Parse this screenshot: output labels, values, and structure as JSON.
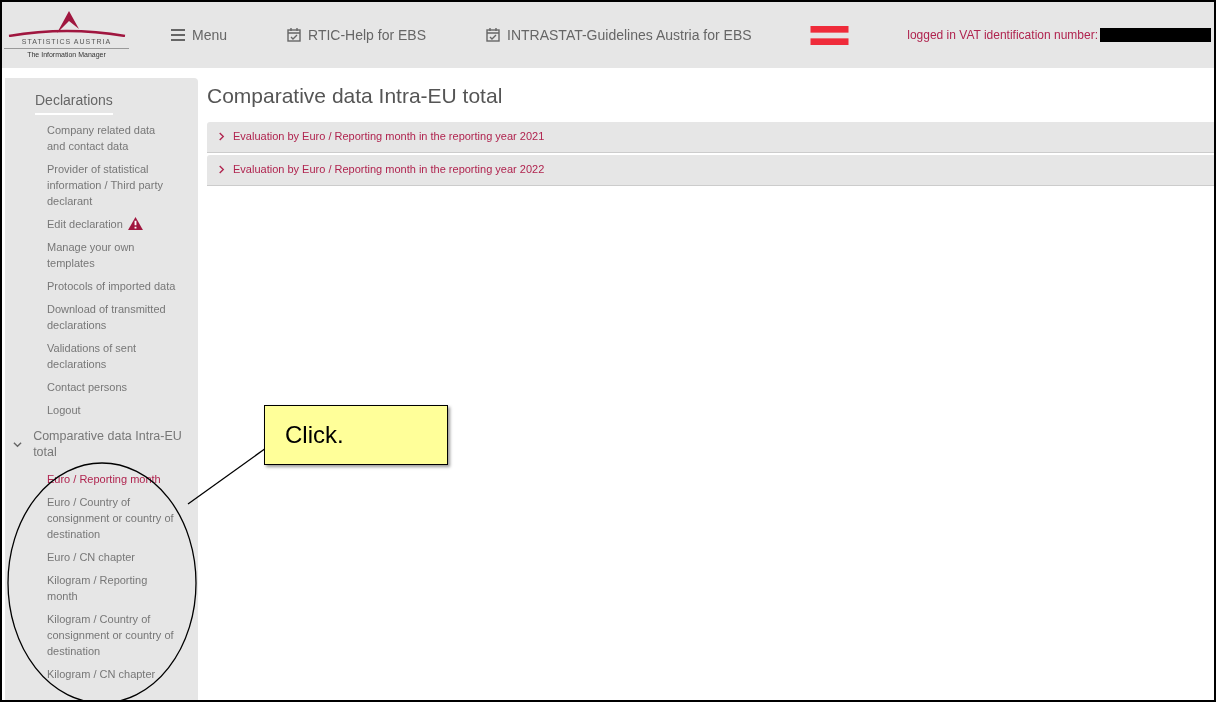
{
  "header": {
    "logo": {
      "name": "STATISTICS AUSTRIA",
      "tagline": "The Information Manager"
    },
    "nav": [
      {
        "kind": "menu",
        "label": "Menu"
      },
      {
        "kind": "calendar",
        "label": "RTIC-Help for EBS"
      },
      {
        "kind": "calendar",
        "label": "INTRASTAT-Guidelines Austria for EBS"
      }
    ],
    "login_label": "logged in VAT identification number:"
  },
  "sidebar": {
    "sections": [
      {
        "kind": "heading",
        "title": "Declarations",
        "items": [
          {
            "label": "Company related data and contact data",
            "selected": false,
            "warning": false
          },
          {
            "label": "Provider of statistical information / Third party declarant",
            "selected": false,
            "warning": false
          },
          {
            "label": "Edit declaration",
            "selected": false,
            "warning": true
          },
          {
            "label": "Manage your own templates",
            "selected": false,
            "warning": false
          },
          {
            "label": "Protocols of imported data",
            "selected": false,
            "warning": false
          },
          {
            "label": "Download of transmitted declarations",
            "selected": false,
            "warning": false
          },
          {
            "label": "Validations of sent declarations",
            "selected": false,
            "warning": false
          },
          {
            "label": "Contact persons",
            "selected": false,
            "warning": false
          },
          {
            "label": "Logout",
            "selected": false,
            "warning": false
          }
        ]
      },
      {
        "kind": "group",
        "title": "Comparative data Intra-EU total",
        "expanded": true,
        "items": [
          {
            "label": "Euro / Reporting month",
            "selected": true,
            "warning": false
          },
          {
            "label": "Euro / Country of consignment or country of destination",
            "selected": false,
            "warning": false
          },
          {
            "label": "Euro / CN chapter",
            "selected": false,
            "warning": false
          },
          {
            "label": "Kilogram / Reporting month",
            "selected": false,
            "warning": false
          },
          {
            "label": "Kilogram / Country of consignment or country of destination",
            "selected": false,
            "warning": false
          },
          {
            "label": "Kilogram / CN chapter",
            "selected": false,
            "warning": false
          }
        ]
      }
    ]
  },
  "main": {
    "title": "Comparative data Intra-EU total",
    "panels": [
      {
        "label": "Evaluation by Euro / Reporting month in the reporting year 2021",
        "expanded": false
      },
      {
        "label": "Evaluation by Euro / Reporting month in the reporting year 2022",
        "expanded": false
      }
    ]
  },
  "callout": {
    "text": "Click."
  }
}
